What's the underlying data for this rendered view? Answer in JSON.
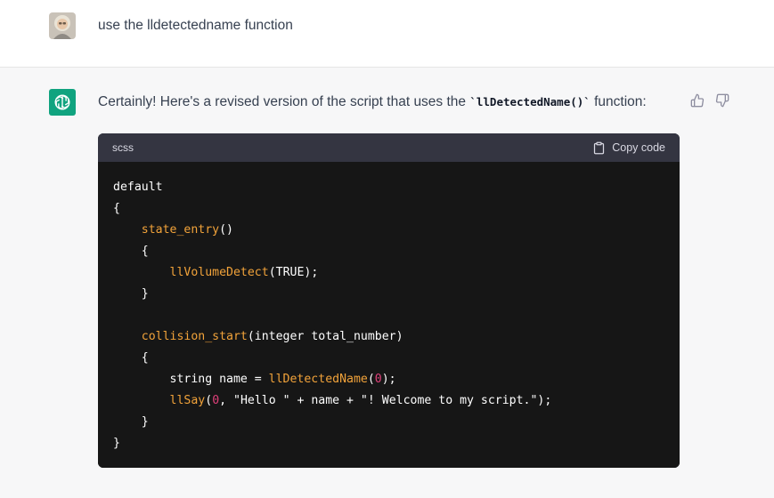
{
  "user_message": {
    "text": "use the lldetectedname function"
  },
  "assistant_message": {
    "text_before": "Certainly! Here's a revised version of the script that uses the ",
    "inline_code": "`llDetectedName()`",
    "text_after": " function:"
  },
  "feedback": {
    "thumbs_up_icon": "thumbs-up-icon",
    "thumbs_down_icon": "thumbs-down-icon"
  },
  "code_block": {
    "language": "scss",
    "copy_label": "Copy code",
    "lines": [
      [
        {
          "t": "default",
          "c": "plain"
        }
      ],
      [
        {
          "t": "{",
          "c": "plain"
        }
      ],
      [
        {
          "t": "    ",
          "c": "plain"
        },
        {
          "t": "state_entry",
          "c": "fn"
        },
        {
          "t": "()",
          "c": "plain"
        }
      ],
      [
        {
          "t": "    {",
          "c": "plain"
        }
      ],
      [
        {
          "t": "        ",
          "c": "plain"
        },
        {
          "t": "llVolumeDetect",
          "c": "fn"
        },
        {
          "t": "(TRUE);",
          "c": "plain"
        }
      ],
      [
        {
          "t": "    }",
          "c": "plain"
        }
      ],
      [
        {
          "t": "",
          "c": "plain"
        }
      ],
      [
        {
          "t": "    ",
          "c": "plain"
        },
        {
          "t": "collision_start",
          "c": "fn"
        },
        {
          "t": "(integer total_number)",
          "c": "plain"
        }
      ],
      [
        {
          "t": "    {",
          "c": "plain"
        }
      ],
      [
        {
          "t": "        string name = ",
          "c": "plain"
        },
        {
          "t": "llDetectedName",
          "c": "fn"
        },
        {
          "t": "(",
          "c": "plain"
        },
        {
          "t": "0",
          "c": "num"
        },
        {
          "t": ");",
          "c": "plain"
        }
      ],
      [
        {
          "t": "        ",
          "c": "plain"
        },
        {
          "t": "llSay",
          "c": "fn"
        },
        {
          "t": "(",
          "c": "plain"
        },
        {
          "t": "0",
          "c": "num"
        },
        {
          "t": ", \"Hello \" + name + \"! Welcome to my script.\");",
          "c": "plain"
        }
      ],
      [
        {
          "t": "    }",
          "c": "plain"
        }
      ],
      [
        {
          "t": "}",
          "c": "plain"
        }
      ]
    ]
  },
  "colors": {
    "accent": "#10a37f",
    "function": "#f2a33a",
    "number": "#e0407a"
  }
}
